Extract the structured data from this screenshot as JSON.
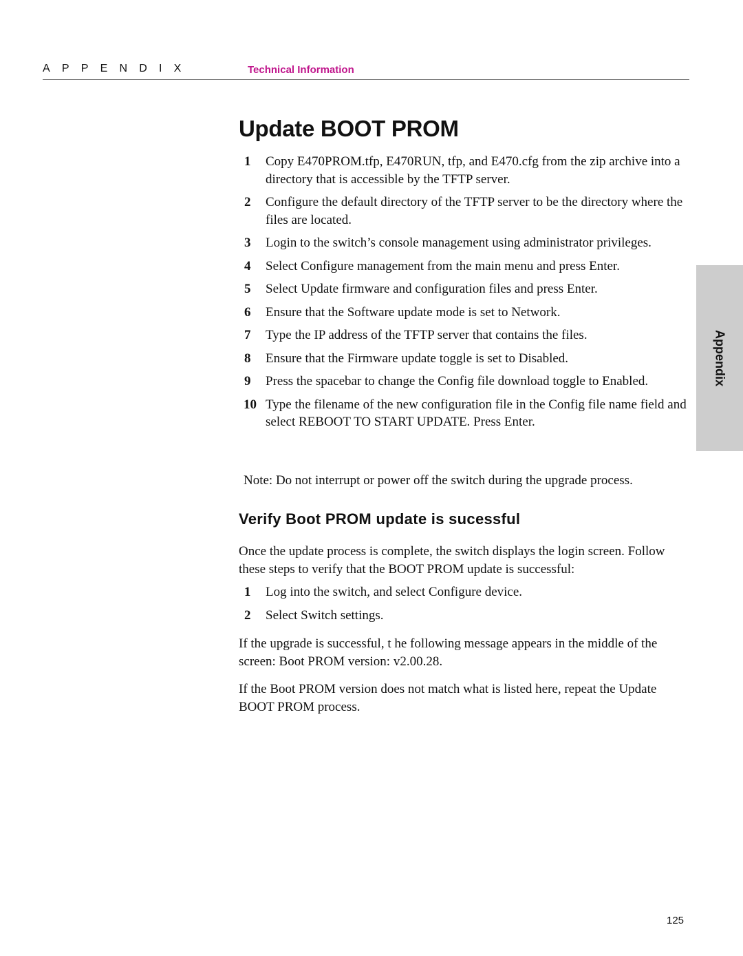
{
  "header": {
    "appendix_label": "APPENDIX",
    "section_label": "Technical Information",
    "section_color": "#c0168c"
  },
  "title": "Update BOOT PROM",
  "steps": [
    {
      "num": "1",
      "text": "Copy E470PROM.tfp, E470RUN, tfp, and E470.cfg from the zip archive into a directory that is accessible by the TFTP server."
    },
    {
      "num": "2",
      "text": "Configure the default directory of the TFTP server to be the directory where the files are located."
    },
    {
      "num": "3",
      "text": "Login to the switch’s console management using administrator privileges."
    },
    {
      "num": "4",
      "text": "Select Configure management from the main menu and press Enter."
    },
    {
      "num": "5",
      "text": "Select Update firmware and configuration files and press Enter."
    },
    {
      "num": "6",
      "text": "Ensure that the Software update mode is set to Network."
    },
    {
      "num": "7",
      "text": "Type the IP address of the TFTP server that contains the files."
    },
    {
      "num": "8",
      "text": "Ensure that the Firmware update toggle is set  to Disabled."
    },
    {
      "num": "9",
      "text": "Press the spacebar to change the Config file download toggle to Enabled."
    },
    {
      "num": "10",
      "text": "Type the filename of the new configuration file in the Config file name field and select REBOOT TO START UPDATE. Press Enter."
    }
  ],
  "note": "Note: Do not interrupt or power off the switch during the upgrade process.",
  "verify": {
    "heading": "Verify Boot PROM update is sucessful",
    "intro": "Once the update process is complete, the switch displays the login screen. Follow these steps to verify that the BOOT PROM update is successful:",
    "steps": [
      {
        "num": "1",
        "text": "Log into the switch, and select Configure device."
      },
      {
        "num": "2",
        "text": "Select Switch settings."
      }
    ],
    "success_message": "If the upgrade is successful, t he following message appears in the middle of the screen: Boot PROM version: v2.00.28.",
    "mismatch_message": "If the Boot PROM version does not match what is listed here, repeat the Update BOOT PROM process."
  },
  "side_tab": {
    "label": "Appendix"
  },
  "page_number": "125"
}
